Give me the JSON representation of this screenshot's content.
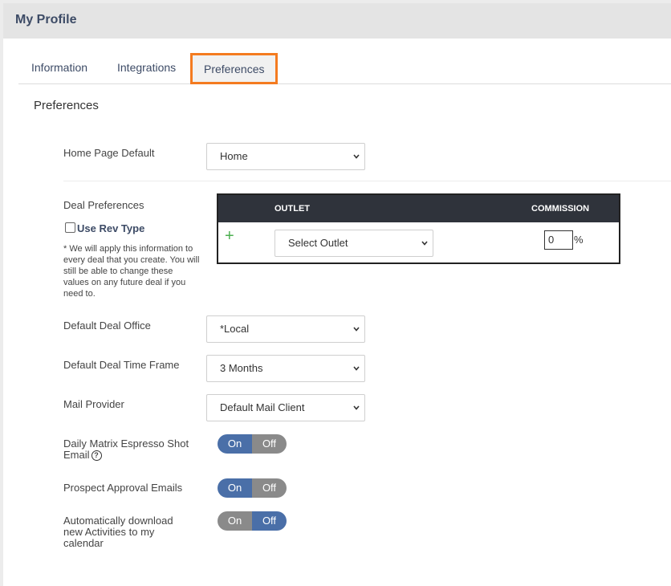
{
  "header": {
    "title": "My Profile"
  },
  "tabs": [
    {
      "label": "Information"
    },
    {
      "label": "Integrations"
    },
    {
      "label": "Preferences"
    }
  ],
  "section": {
    "title": "Preferences"
  },
  "home_page": {
    "label": "Home Page Default",
    "value": "Home"
  },
  "deal_preferences": {
    "label": "Deal Preferences",
    "use_rev_type": "Use Rev Type",
    "note": "* We will apply this information to every deal that you create. You will still be able to change these values on any future deal if you need to.",
    "table": {
      "col_outlet": "OUTLET",
      "col_commission": "COMMISSION",
      "plus": "+",
      "outlet_value": "Select Outlet",
      "commission_value": "0",
      "commission_unit": "%"
    }
  },
  "deal_office": {
    "label": "Default Deal Office",
    "value": "*Local"
  },
  "deal_timeframe": {
    "label": "Default Deal Time Frame",
    "value": "3 Months"
  },
  "mail_provider": {
    "label": "Mail Provider",
    "value": "Default Mail Client"
  },
  "toggles": {
    "on_label": "On",
    "off_label": "Off",
    "espresso": {
      "label1": "Daily Matrix Espresso Shot",
      "label2": "Email",
      "help": "?",
      "state": "On"
    },
    "prospect": {
      "label": "Prospect Approval Emails",
      "state": "On"
    },
    "auto_download": {
      "label1": "Automatically download",
      "label2": "new Activities to my",
      "label3": "calendar",
      "state": "Off"
    }
  },
  "colors": {
    "accent": "#4a6fa8",
    "tab_highlight": "#f47b20",
    "plus": "#4caf50"
  },
  "icons": {
    "chevron": "chevron-down-icon",
    "plus": "plus-icon",
    "help": "help-circle-icon"
  }
}
